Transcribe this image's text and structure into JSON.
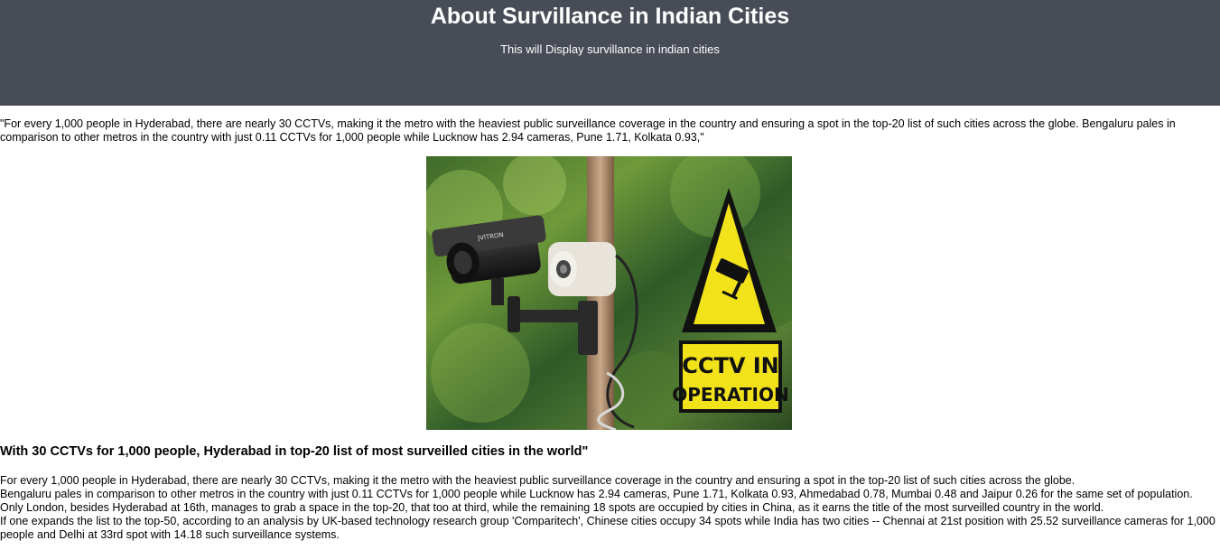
{
  "header": {
    "title": "About Survillance in Indian Cities",
    "subtitle": "This will Display survillance in indian cities"
  },
  "quote": "\"For every 1,000 people in Hyderabad, there are nearly 30 CCTVs, making it the metro with the heaviest public surveillance coverage in the country and ensuring a spot in the top-20 list of such cities across the globe. Bengaluru pales in comparison to other metros in the country with just 0.11 CCTVs for 1,000 people while Lucknow has 2.94 cameras, Pune 1.71, Kolkata 0.93,\"",
  "image": {
    "camera_brand": "JVITRON",
    "sign_line1": "CCTV IN",
    "sign_line2": "OPERATION"
  },
  "headline": "With 30 CCTVs for 1,000 people, Hyderabad in top-20 list of most surveilled cities in the world\"",
  "article": [
    "For every 1,000 people in Hyderabad, there are nearly 30 CCTVs, making it the metro with the heaviest public surveillance coverage in the country and ensuring a spot in the top-20 list of such cities across the globe.",
    "Bengaluru pales in comparison to other metros in the country with just 0.11 CCTVs for 1,000 people while Lucknow has 2.94 cameras, Pune 1.71, Kolkata 0.93, Ahmedabad 0.78, Mumbai 0.48 and Jaipur 0.26 for the same set of population.",
    "Only London, besides Hyderabad at 16th, manages to grab a space in the top-20, that too at third, while the remaining 18 spots are occupied by cities in China, as it earns the title of the most surveilled country in the world.",
    "If one expands the list to the top-50,  according to an analysis by UK-based technology research group 'Comparitech', Chinese cities occupy 34 spots while India has two cities -- Chennai at 21st position with 25.52 surveillance cameras for 1,000 people and Delhi at 33rd spot with 14.18 such surveillance systems."
  ]
}
